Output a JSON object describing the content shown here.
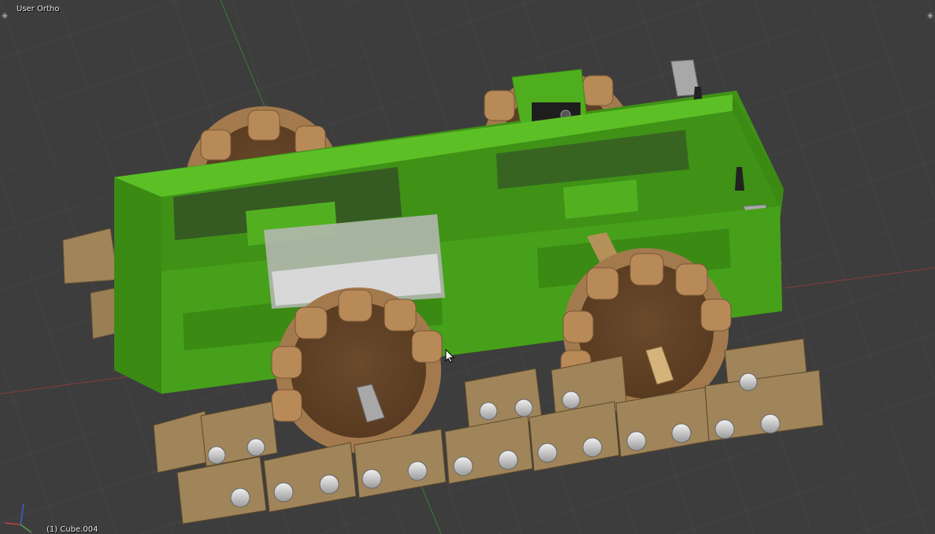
{
  "viewport": {
    "view_label": "User Ortho",
    "object_label": "(1) Cube.004"
  },
  "colors": {
    "background": "#3d3d3d",
    "grid": "#4a4a4a",
    "frame_green": "#47a01a",
    "sprocket_brown": "#7a5636",
    "track_tan": "#a0855a",
    "pin_silver": "#d0d0d0",
    "axis_x": "#c04040",
    "axis_y": "#50a050",
    "axis_z": "#4060d0"
  },
  "icons": [
    "corner-plus-icon",
    "axis-gizmo-icon",
    "mouse-cursor-icon",
    "servo-motor-icon"
  ]
}
